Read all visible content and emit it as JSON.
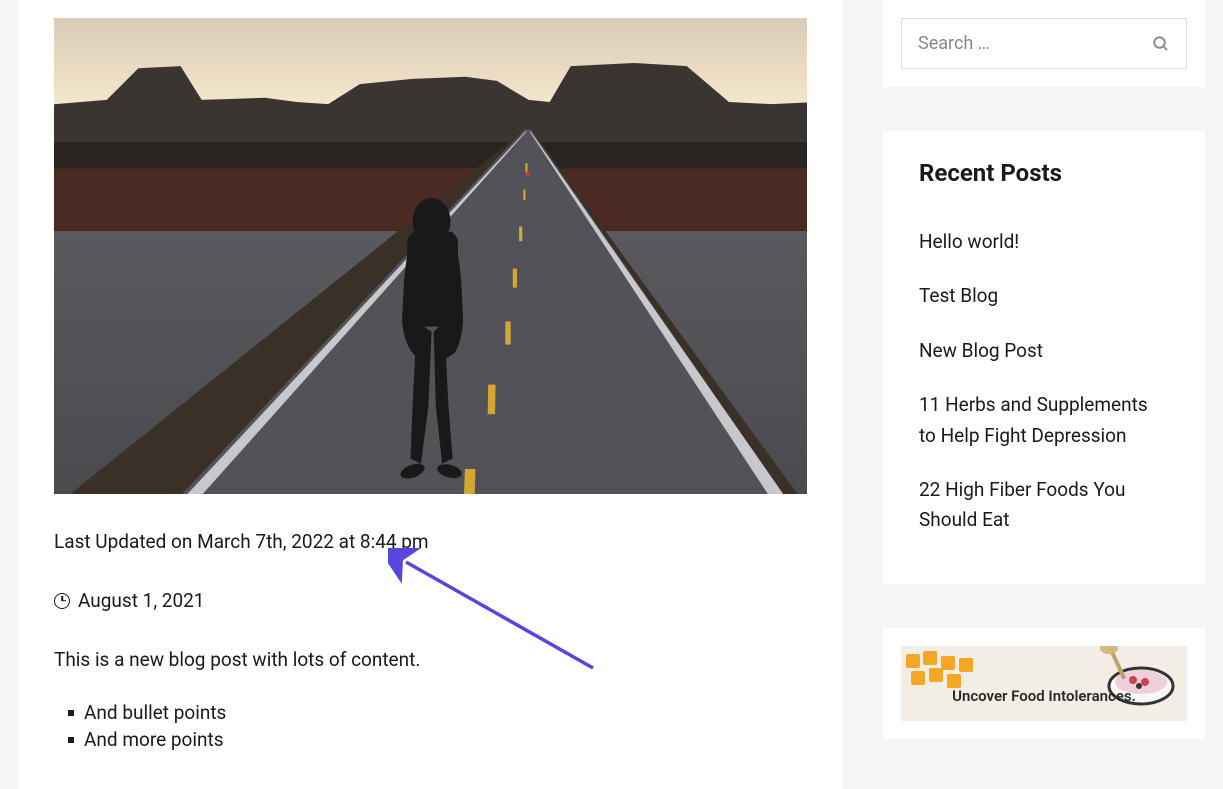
{
  "post": {
    "last_updated": "Last Updated on March 7th, 2022 at 8:44 pm",
    "date": "August 1, 2021",
    "content": "This is a new blog post with lots of content.",
    "bullets": [
      "And bullet points",
      "And more points"
    ]
  },
  "sidebar": {
    "search_placeholder": "Search …",
    "recent_posts_title": "Recent Posts",
    "recent_posts": [
      "Hello world!",
      "Test Blog",
      "New Blog Post",
      "11 Herbs and Supplements to Help Fight Depression",
      "22 High Fiber Foods You Should Eat"
    ],
    "promo_text": "Uncover Food Intolerances."
  },
  "colors": {
    "arrow": "#5845e0"
  }
}
